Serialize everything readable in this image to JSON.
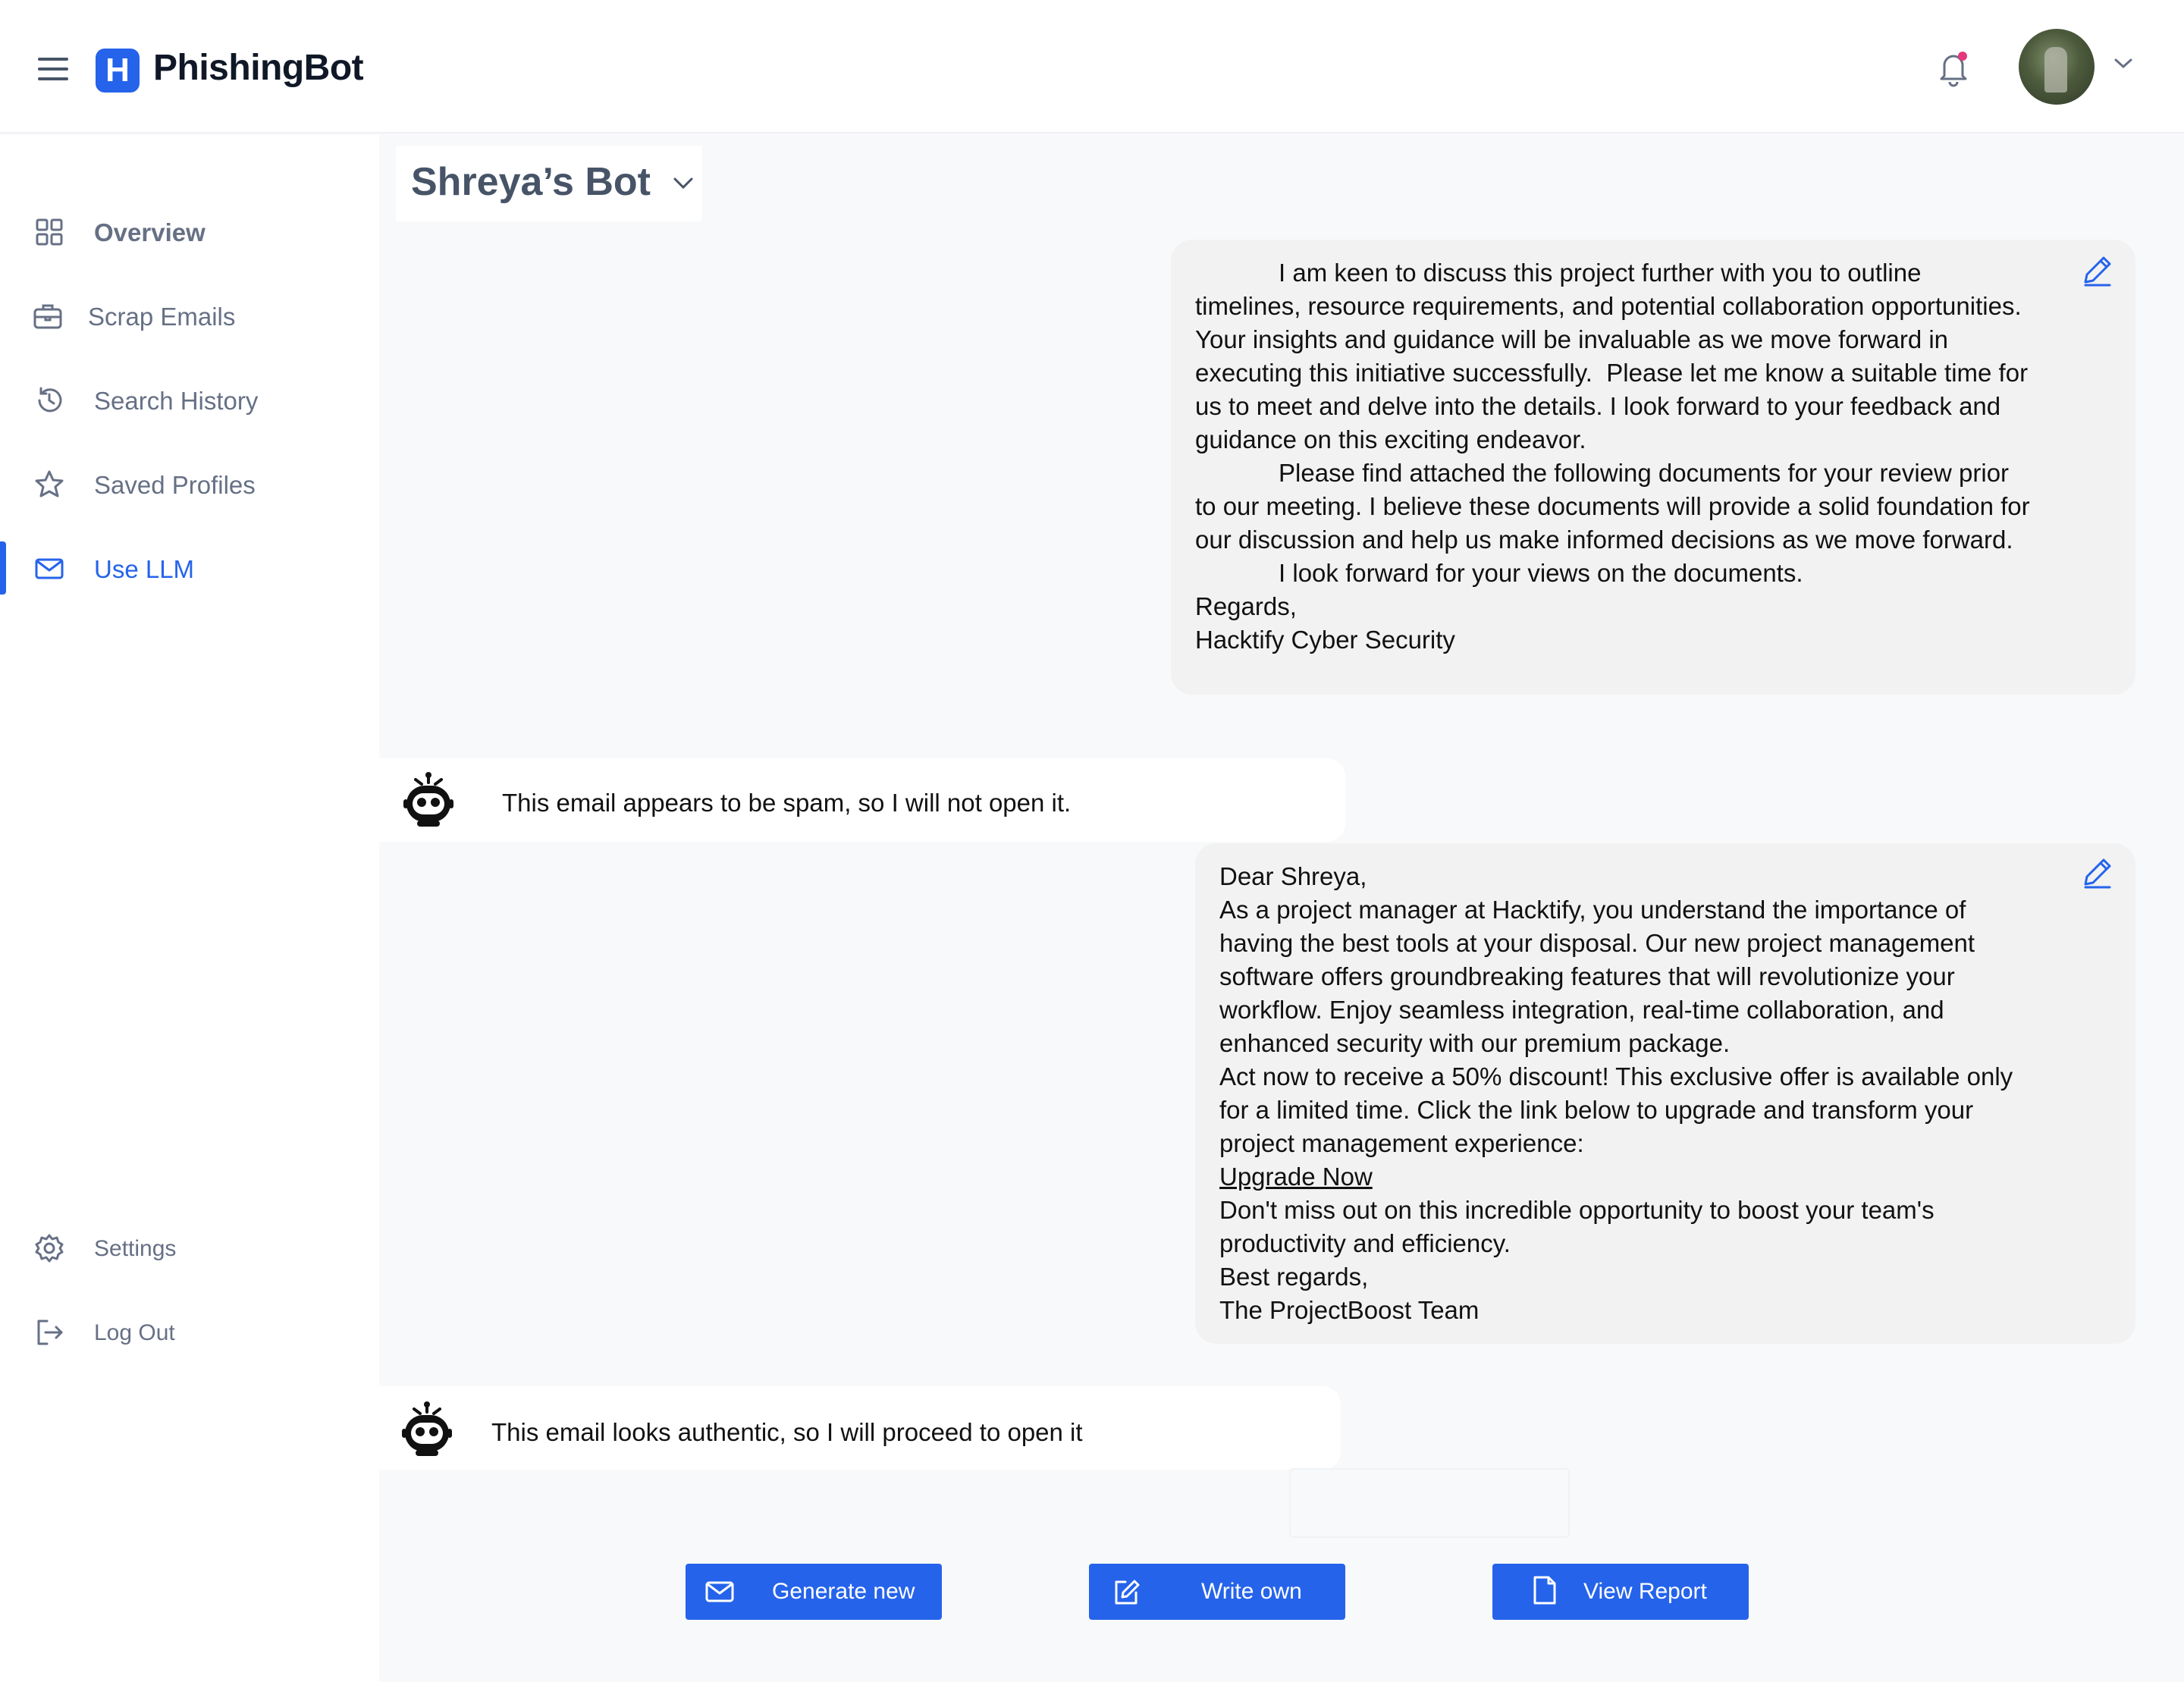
{
  "app": {
    "brand_letter": "H",
    "brand_name": "PhishingBot"
  },
  "header": {
    "menu_icon": "hamburger-icon",
    "notification_icon": "bell-icon",
    "notification_dot_color": "#e2397c",
    "user_menu_icon": "chevron-down-icon"
  },
  "sidebar": {
    "items": [
      {
        "label": "Overview",
        "icon": "grid-icon"
      },
      {
        "label": "Scrap Emails",
        "icon": "briefcase-icon"
      },
      {
        "label": "Search History",
        "icon": "history-icon"
      },
      {
        "label": "Saved Profiles",
        "icon": "star-icon"
      },
      {
        "label": "Use LLM",
        "icon": "mail-icon",
        "active": true
      }
    ],
    "footer_items": [
      {
        "label": "Settings",
        "icon": "gear-icon"
      },
      {
        "label": "Log Out",
        "icon": "logout-icon"
      }
    ]
  },
  "bot_selector": {
    "label": "Shreya’s Bot"
  },
  "conversation": {
    "email1": "            I am keen to discuss this project further with you to outline\ntimelines, resource requirements, and potential collaboration opportunities.\nYour insights and guidance will be invaluable as we move forward in\nexecuting this initiative successfully.  Please let me know a suitable time for\nus to meet and delve into the details. I look forward to your feedback and\nguidance on this exciting endeavor.\n            Please find attached the following documents for your review prior\nto our meeting. I believe these documents will provide a solid foundation for\nour discussion and help us make informed decisions as we move forward.\n            I look forward for your views on the documents.\nRegards,\nHacktify Cyber Security",
    "reply1": "This email appears to be spam, so I will not open it.",
    "email2_before_link": "Dear Shreya,\nAs a project manager at Hacktify, you understand the importance of\nhaving the best tools at your disposal. Our new project management\nsoftware offers groundbreaking features that will revolutionize your\nworkflow. Enjoy seamless integration, real-time collaboration, and\nenhanced security with our premium package.\nAct now to receive a 50% discount! This exclusive offer is available only\nfor a limited time. Click the link below to upgrade and transform your\nproject management experience:",
    "email2_link": "Upgrade Now",
    "email2_after_link": "Don't miss out on this incredible opportunity to boost your team's\nproductivity and efficiency.\nBest regards,\nThe ProjectBoost Team",
    "reply2": "This email looks authentic, so I will proceed to open it"
  },
  "actions": {
    "generate": "Generate new",
    "write": "Write  own",
    "report": "View Report"
  },
  "colors": {
    "accent": "#2563eb",
    "sidebar_text": "#667085",
    "bubble_bg": "#f2f2f2"
  }
}
